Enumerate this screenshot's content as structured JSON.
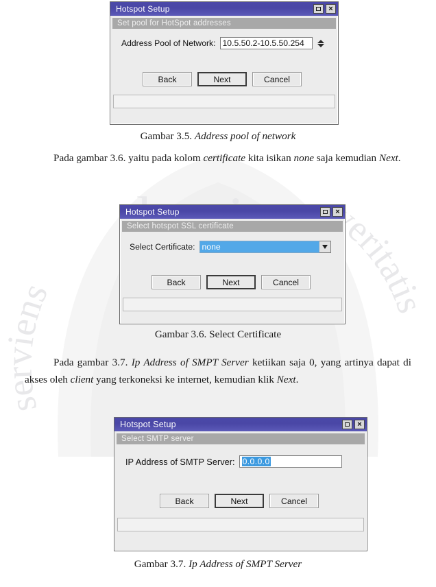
{
  "document": {
    "paragraphs": [
      {
        "id": "paragraph-certificate",
        "indent": true,
        "runs": [
          {
            "text": "Pada gambar 3.6. yaitu pada kolom ",
            "italic": false
          },
          {
            "text": "certificate",
            "italic": true
          },
          {
            "text": "  kita isikan ",
            "italic": false
          },
          {
            "text": "none",
            "italic": true
          },
          {
            "text": " saja kemudian ",
            "italic": false
          },
          {
            "text": "Next",
            "italic": true
          },
          {
            "text": ".",
            "italic": false
          }
        ]
      },
      {
        "id": "paragraph-smtp",
        "indent": true,
        "runs": [
          {
            "text": "Pada gambar 3.7. ",
            "italic": false
          },
          {
            "text": "Ip Address of SMPT Server",
            "italic": true
          },
          {
            "text": " ketiikan saja 0, yang artinya dapat di akses oleh ",
            "italic": false
          },
          {
            "text": "client",
            "italic": true
          },
          {
            "text": " yang terkoneksi ke internet, kemudian klik ",
            "italic": false
          },
          {
            "text": "Next",
            "italic": true
          },
          {
            "text": ".",
            "italic": false
          }
        ]
      }
    ],
    "captions": [
      {
        "id": "caption-3-5",
        "runs": [
          {
            "text": "Gambar 3.5. ",
            "italic": false
          },
          {
            "text": "Address pool  of network",
            "italic": true
          }
        ]
      },
      {
        "id": "caption-3-6",
        "runs": [
          {
            "text": "Gambar 3.6. Select Certificate",
            "italic": false
          }
        ]
      },
      {
        "id": "caption-3-7",
        "runs": [
          {
            "text": "Gambar 3.7. ",
            "italic": false
          },
          {
            "text": "Ip Address of SMPT Server",
            "italic": true
          }
        ]
      }
    ],
    "watermark": {
      "words": [
        "lumine",
        "serviens",
        "veritatis"
      ]
    }
  },
  "dialogs": [
    {
      "id": "address-pool",
      "title": "Hotspot Setup",
      "subtitle": "Set pool for HotSpot addresses",
      "field_label": "Address Pool of Network:",
      "field_value": "10.5.50.2-10.5.50.254",
      "control": "spinner",
      "titlebar_buttons": [
        {
          "name": "maximize-icon",
          "glyph": "square"
        },
        {
          "name": "close-icon",
          "glyph": "×"
        }
      ],
      "buttons": [
        {
          "label": "Back",
          "default": false
        },
        {
          "label": "Next",
          "default": true
        },
        {
          "label": "Cancel",
          "default": false
        }
      ],
      "statusbar_text": ""
    },
    {
      "id": "select-certificate",
      "title": "Hotspot Setup",
      "subtitle": "Select hotspot SSL certificate",
      "field_label": "Select Certificate:",
      "field_value": "none",
      "control": "combobox",
      "titlebar_buttons": [
        {
          "name": "maximize-icon",
          "glyph": "square"
        },
        {
          "name": "close-icon",
          "glyph": "×"
        }
      ],
      "buttons": [
        {
          "label": "Back",
          "default": false
        },
        {
          "label": "Next",
          "default": true
        },
        {
          "label": "Cancel",
          "default": false
        }
      ],
      "statusbar_text": ""
    },
    {
      "id": "smtp-server",
      "title": "Hotspot Setup",
      "subtitle": "Select SMTP server",
      "field_label": "IP Address of SMTP Server:",
      "field_value": "0.0.0.0",
      "control": "textbox-selected",
      "titlebar_buttons": [
        {
          "name": "maximize-icon",
          "glyph": "square"
        },
        {
          "name": "close-icon",
          "glyph": "×"
        }
      ],
      "buttons": [
        {
          "label": "Back",
          "default": false
        },
        {
          "label": "Next",
          "default": true
        },
        {
          "label": "Cancel",
          "default": false
        }
      ],
      "statusbar_text": ""
    }
  ],
  "colors": {
    "titlebar": "#4b48a8",
    "subbar": "#a8a8a8",
    "selection": "#3c9ae0",
    "combo_selection": "#52a8e8",
    "dialog_face": "#ececec"
  }
}
